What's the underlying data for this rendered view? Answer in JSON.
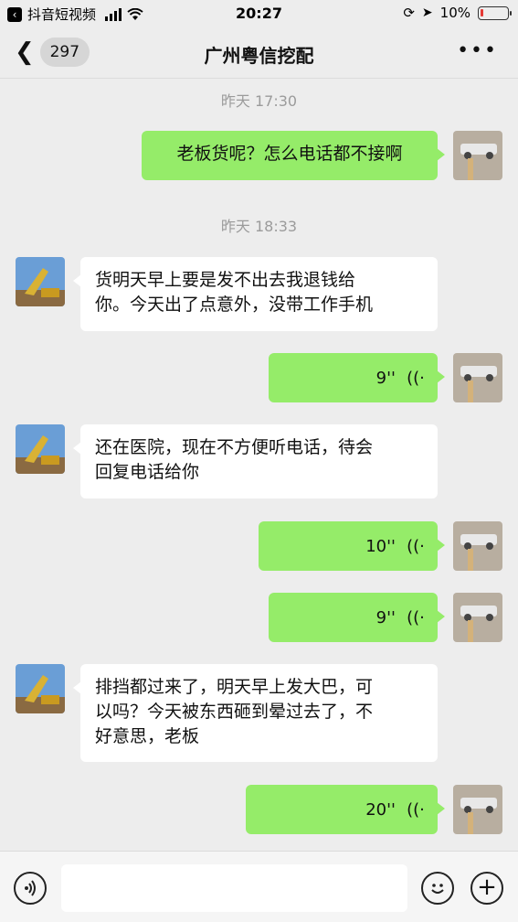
{
  "status_bar": {
    "back_app": "抖音短视频",
    "time": "20:27",
    "battery": "10%",
    "battery_level": 0.1
  },
  "header": {
    "unread_count": "297",
    "title": "广州粤信挖配",
    "more": "•••"
  },
  "messages": [
    {
      "kind": "time",
      "text": "昨天 17:30"
    },
    {
      "kind": "text",
      "from": "me",
      "text": "老板货呢？怎么电话都不接啊"
    },
    {
      "kind": "time",
      "text": "昨天 18:33"
    },
    {
      "kind": "text",
      "from": "them",
      "line1": "货明天早上要是发不出去我退钱给",
      "line2": "你。今天出了点意外，没带工作手机"
    },
    {
      "kind": "voice",
      "from": "me",
      "duration": "9''"
    },
    {
      "kind": "text",
      "from": "them",
      "line1": "还在医院，现在不方便听电话，待会",
      "line2": "回复电话给你"
    },
    {
      "kind": "voice",
      "from": "me",
      "duration": "10''"
    },
    {
      "kind": "voice",
      "from": "me",
      "duration": "9''"
    },
    {
      "kind": "text",
      "from": "them",
      "line1": "排挡都过来了，明天早上发大巴，可",
      "line2": "以吗？今天被东西砸到晕过去了，不",
      "line3": "好意思，老板"
    },
    {
      "kind": "voice",
      "from": "me",
      "duration": "20''"
    }
  ],
  "colors": {
    "my_bubble": "#95ec69",
    "their_bubble": "#ffffff",
    "background": "#ededed"
  },
  "input_bar": {
    "voice_icon": "voice-mode-icon",
    "emoji_icon": "emoji-icon",
    "plus_icon": "plus-icon"
  }
}
